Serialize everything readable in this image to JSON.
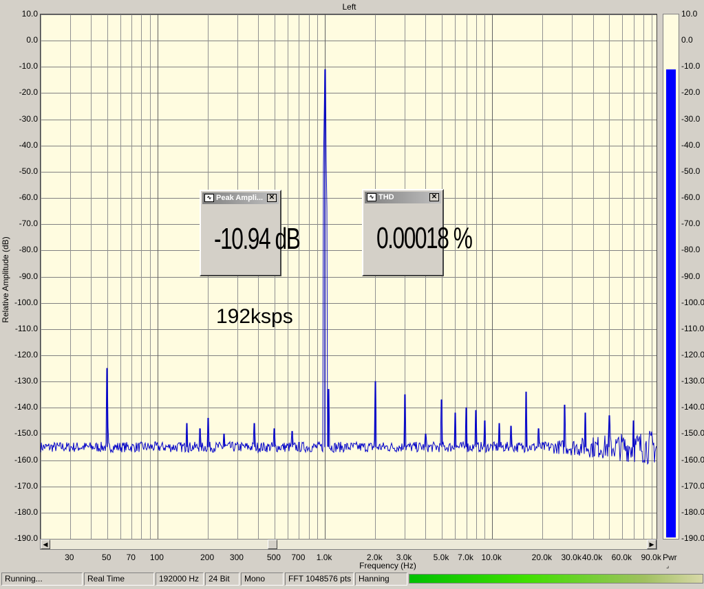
{
  "window": {
    "title": "Left"
  },
  "chart_data": {
    "type": "line",
    "title": "",
    "xlabel": "Frequency (Hz)",
    "ylabel": "Relative Amplitude (dB)",
    "xscale": "log",
    "xlim": [
      20,
      96000
    ],
    "ylim": [
      -190,
      10
    ],
    "grid": true,
    "y_ticks": [
      "10.0",
      "0.0",
      "-10.0",
      "-20.0",
      "-30.0",
      "-40.0",
      "-50.0",
      "-60.0",
      "-70.0",
      "-80.0",
      "-90.0",
      "-100.0",
      "-110.0",
      "-120.0",
      "-130.0",
      "-140.0",
      "-150.0",
      "-160.0",
      "-170.0",
      "-180.0",
      "-190.0"
    ],
    "x_ticks": [
      {
        "v": 30,
        "label": "30"
      },
      {
        "v": 50,
        "label": "50"
      },
      {
        "v": 70,
        "label": "70"
      },
      {
        "v": 100,
        "label": "100"
      },
      {
        "v": 200,
        "label": "200"
      },
      {
        "v": 300,
        "label": "300"
      },
      {
        "v": 500,
        "label": "500"
      },
      {
        "v": 700,
        "label": "700"
      },
      {
        "v": 1000,
        "label": "1.0k"
      },
      {
        "v": 2000,
        "label": "2.0k"
      },
      {
        "v": 3000,
        "label": "3.0k"
      },
      {
        "v": 5000,
        "label": "5.0k"
      },
      {
        "v": 7000,
        "label": "7.0k"
      },
      {
        "v": 10000,
        "label": "10.0k"
      },
      {
        "v": 20000,
        "label": "20.0k"
      },
      {
        "v": 30000,
        "label": "30.0k"
      },
      {
        "v": 40000,
        "label": "40.0k"
      },
      {
        "v": 60000,
        "label": "60.0k"
      },
      {
        "v": 90000,
        "label": "90.0k"
      }
    ],
    "series": [
      {
        "color": "#0000c8",
        "noise_floor_db": -155,
        "peaks": [
          {
            "x": 50,
            "y": -125
          },
          {
            "x": 150,
            "y": -146
          },
          {
            "x": 180,
            "y": -148
          },
          {
            "x": 200,
            "y": -144
          },
          {
            "x": 250,
            "y": -150
          },
          {
            "x": 380,
            "y": -146
          },
          {
            "x": 500,
            "y": -148
          },
          {
            "x": 640,
            "y": -149
          },
          {
            "x": 1000,
            "y": -11
          },
          {
            "x": 1050,
            "y": -133
          },
          {
            "x": 2000,
            "y": -130
          },
          {
            "x": 3000,
            "y": -135
          },
          {
            "x": 4000,
            "y": -150
          },
          {
            "x": 5000,
            "y": -137
          },
          {
            "x": 6000,
            "y": -142
          },
          {
            "x": 7000,
            "y": -140
          },
          {
            "x": 8000,
            "y": -141
          },
          {
            "x": 9000,
            "y": -145
          },
          {
            "x": 11000,
            "y": -146
          },
          {
            "x": 13000,
            "y": -147
          },
          {
            "x": 16000,
            "y": -134
          },
          {
            "x": 19000,
            "y": -148
          },
          {
            "x": 27000,
            "y": -139
          },
          {
            "x": 36000,
            "y": -142
          },
          {
            "x": 50000,
            "y": -143
          },
          {
            "x": 70000,
            "y": -145
          }
        ]
      }
    ]
  },
  "meter": {
    "level_db": -10.94,
    "ticks": [
      "10.0",
      "0.0",
      "-10.0",
      "-20.0",
      "-30.0",
      "-40.0",
      "-50.0",
      "-60.0",
      "-70.0",
      "-80.0",
      "-90.0",
      "-100.0",
      "-110.0",
      "-120.0",
      "-130.0",
      "-140.0",
      "-150.0",
      "-160.0",
      "-170.0",
      "-180.0",
      "-190.0"
    ],
    "label": "Pwr"
  },
  "peak_window": {
    "title": "Peak Ampli...",
    "value": "-10.94 dB"
  },
  "thd_window": {
    "title": "THD",
    "value": "0.00018 %"
  },
  "annotation": "192ksps",
  "status": {
    "state": "Running...",
    "mode": "Real Time",
    "rate": "192000 Hz",
    "bits": "24 Bit",
    "channels": "Mono",
    "fft": "FFT 1048576 pts",
    "window": "Hanning"
  }
}
